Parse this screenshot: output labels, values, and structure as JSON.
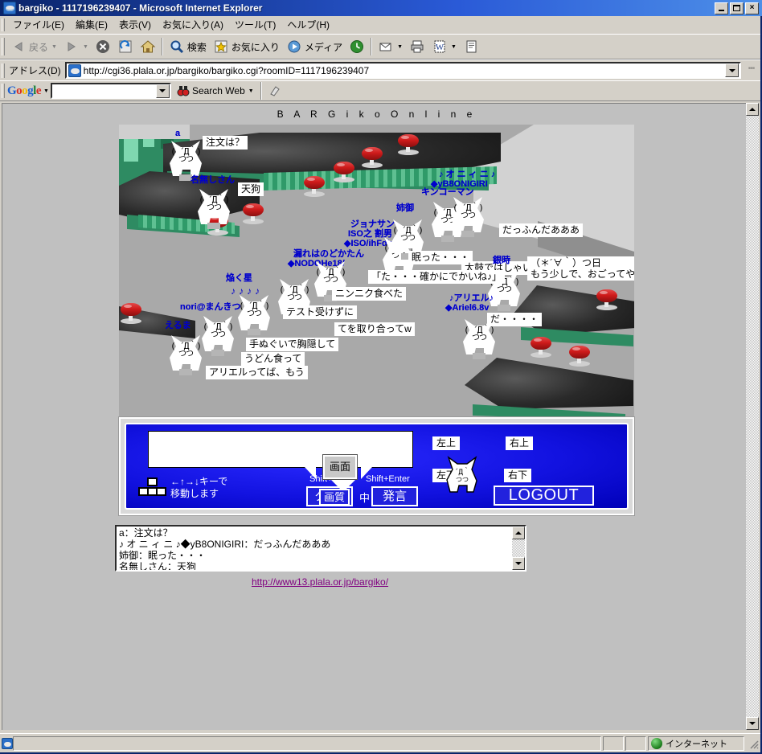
{
  "window": {
    "title": "bargiko - 1117196239407 - Microsoft Internet Explorer",
    "icon": "ie-icon",
    "minimize": "minimize-icon",
    "maximize": "maximize-icon",
    "close": "×"
  },
  "menubar": {
    "items": [
      {
        "label": "ファイル(E)",
        "name": "menu-file"
      },
      {
        "label": "編集(E)",
        "name": "menu-edit"
      },
      {
        "label": "表示(V)",
        "name": "menu-view"
      },
      {
        "label": "お気に入り(A)",
        "name": "menu-favorites"
      },
      {
        "label": "ツール(T)",
        "name": "menu-tools"
      },
      {
        "label": "ヘルプ(H)",
        "name": "menu-help"
      }
    ]
  },
  "toolbar": {
    "back": "戻る",
    "forward": "",
    "stop": "stop-icon",
    "refresh": "refresh-icon",
    "home": "home-icon",
    "search": "検索",
    "favorites": "お気に入り",
    "media": "メディア",
    "history": "history-icon",
    "mail": "mail-icon",
    "print": "print-icon",
    "edit": "edit-icon",
    "discuss": "discuss-icon"
  },
  "address": {
    "label": "アドレス(D)",
    "url": "http://cgi36.plala.or.jp/bargiko/bargiko.cgi?roomID=1117196239407",
    "links": "\"\""
  },
  "googlebar": {
    "logo": "Google",
    "search_value": "",
    "search_button": "Search Web",
    "highlight": "highlight-icon"
  },
  "game": {
    "title": "B A R G i k o   O n l i n e",
    "characters": [
      {
        "name": "a",
        "face": "( ´Д｀)",
        "face2": "つつ"
      },
      {
        "name": "名無しさん",
        "face": "( ´Д｀)",
        "face2": "つつ"
      },
      {
        "name": "えるま",
        "face": "( ´Д｀)",
        "face2": "つつ"
      },
      {
        "name": "nori@まんきつ",
        "face": "( ´Д｀)",
        "face2": "つつ"
      },
      {
        "name": "焔く星",
        "face": "( ´Д｀)",
        "face2": "つつ"
      },
      {
        "name": "漏れはのどかたん",
        "trip": "◆NODOHe18/",
        "face": "( ´Д｀)",
        "face2": "つつ"
      },
      {
        "name": "ISO之 割男",
        "trip": "◆ISO/ihFdbY",
        "face": "( ´Д｀)",
        "face2": "つつ"
      },
      {
        "name": "ジョナサン",
        "face": "( ´Д｀)",
        "face2": "つつ"
      },
      {
        "name": "姉御",
        "face": "( ´Д｀)",
        "face2": "つつ"
      },
      {
        "name": "キンコーマン",
        "face": "( ´Д｀)",
        "face2": "つつ"
      },
      {
        "name": "♪ オ ニ ィ ニ ♪",
        "trip": "◆yB8ONIGIRI",
        "face": "( ´Д｀)",
        "face2": "つつ"
      },
      {
        "name": "銀時",
        "face": "( ´Д｀)",
        "face2": "つつ"
      },
      {
        "name": "♪アリエル♪",
        "trip": "◆Ariel6.8v",
        "face": "( ´Д｀)",
        "face2": "つつ"
      }
    ],
    "bubbles": [
      "注文は？",
      "天狗",
      "アリエルってば、もう",
      "うどん食って",
      "手ぬぐいで胸隠して",
      "てを取り合ってw",
      "テスト受けずに",
      "ニンニク食べた",
      "「た・・・確かにでかいね♪」",
      "眠った・・・",
      "太鼓ではしゃいだ",
      "だっふんだあああ",
      "（＊´∀｀）つ日\nもう少しで、おごってやる・",
      "だ・・・・"
    ]
  },
  "panel": {
    "chat_value": "",
    "move_hint": "←↑→↓キーで\n移動します",
    "clear_shortcut": "Shift+Del",
    "clear_label": "クリア",
    "send_shortcut": "Shift+Enter",
    "send_label": "発言",
    "screen_label": "画面",
    "quality_label": "画質",
    "quality_value": "中",
    "corner_upleft": "左上",
    "corner_upright": "右上",
    "corner_downleft": "左下",
    "corner_downright": "右下",
    "logout_label": "LOGOUT"
  },
  "log": {
    "lines": "a：注文は？\n♪ オ ニ ィ ニ ♪◆yB8ONIGIRI：だっふんだあああ\n姉御：眠った・・・\n名無しさん：天狗"
  },
  "footer": {
    "link": "http://www13.plala.or.jp/bargiko/"
  },
  "statusbar": {
    "message": "",
    "zone": "インターネット"
  },
  "colors": {
    "accent": "#0000cc",
    "panel_blue": "#1212e0",
    "titlebar": "#0a246a",
    "link": "#800080"
  }
}
